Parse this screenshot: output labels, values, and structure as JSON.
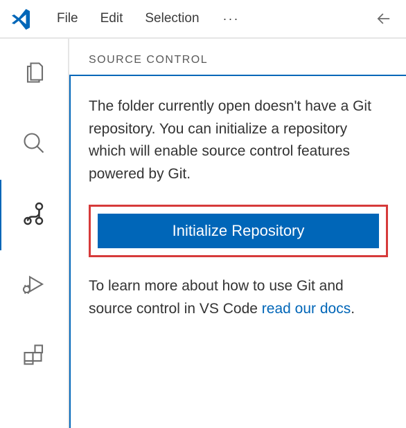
{
  "menu": {
    "file": "File",
    "edit": "Edit",
    "selection": "Selection"
  },
  "sidebar": {
    "section_title": "SOURCE CONTROL",
    "info_text": "The folder currently open doesn't have a Git repository. You can initialize a repository which will enable source control features powered by Git.",
    "primary_button_label": "Initialize Repository",
    "learn_prefix": "To learn more about how to use Git and source control in VS Code ",
    "learn_link": "read our docs",
    "learn_suffix": "."
  },
  "colors": {
    "accent": "#0066b8",
    "highlight_border": "#d63a3a"
  }
}
